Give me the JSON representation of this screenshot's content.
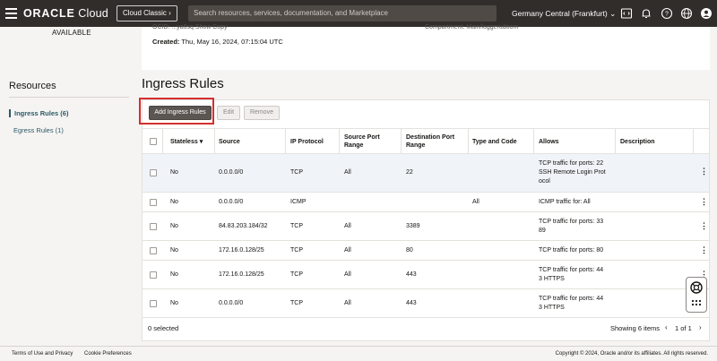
{
  "header": {
    "logo_brand": "ORACLE",
    "logo_product": "Cloud",
    "cloud_classic_label": "Cloud Classic",
    "search_placeholder": "Search resources, services, documentation, and Marketplace",
    "region": "Germany Central (Frankfurt)",
    "icons": [
      "menu-icon",
      "code-editor-icon",
      "bell-icon",
      "help-icon",
      "globe-icon",
      "user-icon"
    ]
  },
  "details": {
    "state": "AVAILABLE",
    "ocid_text": "OCID: ...ya6sq   Show   Copy",
    "compartment_text": "Compartment: Main/loggerudoom",
    "created_label": "Created:",
    "created_value": "Thu, May 16, 2024, 07:15:04 UTC"
  },
  "resources": {
    "title": "Resources",
    "items": [
      {
        "label": "Ingress Rules (6)",
        "active": true
      },
      {
        "label": "Egress Rules (1)",
        "active": false
      }
    ]
  },
  "page_title": "Ingress Rules",
  "toolbar": {
    "add_label": "Add Ingress Rules",
    "edit_label": "Edit",
    "remove_label": "Remove"
  },
  "table": {
    "headers": {
      "stateless": "Stateless",
      "source": "Source",
      "ip_protocol": "IP Protocol",
      "source_port_1": "Source Port",
      "source_port_2": "Range",
      "dest_port_1": "Destination Port",
      "dest_port_2": "Range",
      "type_code": "Type and Code",
      "allows": "Allows",
      "description": "Description"
    },
    "rows": [
      {
        "stateless": "No",
        "source": "0.0.0.0/0",
        "protocol": "TCP",
        "src_port": "All",
        "dst_port": "22",
        "type_code": "",
        "allows": [
          "TCP traffic for ports: 22",
          "SSH Remote Login Prot",
          "ocol"
        ],
        "description": ""
      },
      {
        "stateless": "No",
        "source": "0.0.0.0/0",
        "protocol": "ICMP",
        "src_port": "",
        "dst_port": "",
        "type_code": "All",
        "allows": [
          "ICMP traffic for: All"
        ],
        "description": ""
      },
      {
        "stateless": "No",
        "source": "84.83.203.184/32",
        "protocol": "TCP",
        "src_port": "All",
        "dst_port": "3389",
        "type_code": "",
        "allows": [
          "TCP traffic for ports: 33",
          "89"
        ],
        "description": ""
      },
      {
        "stateless": "No",
        "source": "172.16.0.128/25",
        "protocol": "TCP",
        "src_port": "All",
        "dst_port": "80",
        "type_code": "",
        "allows": [
          "TCP traffic for ports: 80"
        ],
        "description": ""
      },
      {
        "stateless": "No",
        "source": "172.16.0.128/25",
        "protocol": "TCP",
        "src_port": "All",
        "dst_port": "443",
        "type_code": "",
        "allows": [
          "TCP traffic for ports: 44",
          "3 HTTPS"
        ],
        "description": ""
      },
      {
        "stateless": "No",
        "source": "0.0.0.0/0",
        "protocol": "TCP",
        "src_port": "All",
        "dst_port": "443",
        "type_code": "",
        "allows": [
          "TCP traffic for ports: 44",
          "3 HTTPS"
        ],
        "description": ""
      }
    ],
    "selected_count": "0 selected",
    "showing": "Showing 6 items",
    "page_info": "1 of 1"
  },
  "footer": {
    "terms": "Terms of Use and Privacy",
    "cookies": "Cookie Preferences",
    "copyright": "Copyright © 2024, Oracle and/or its affiliates. All rights reserved."
  }
}
